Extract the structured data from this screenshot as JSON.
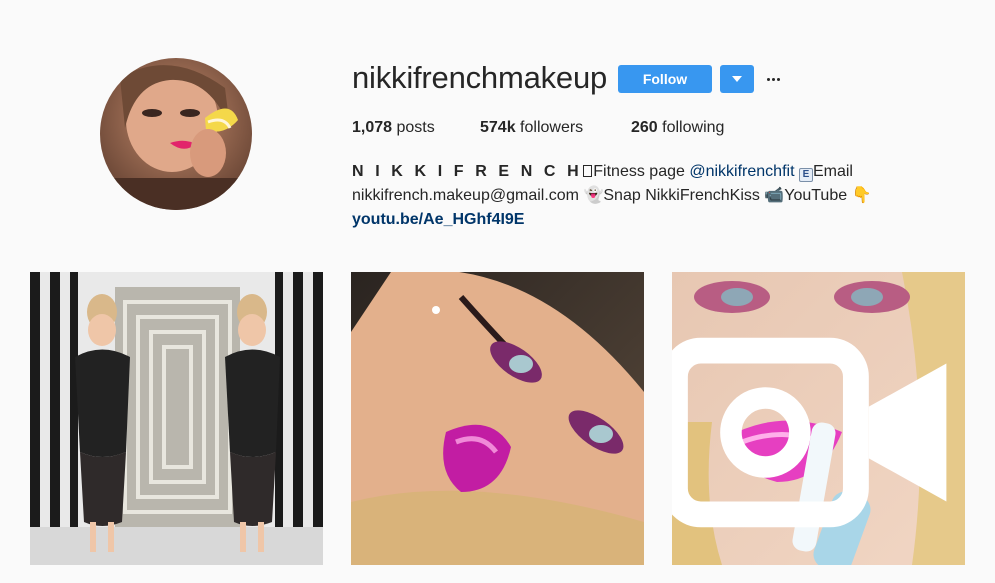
{
  "profile": {
    "username": "nikkifrenchmakeup",
    "follow_label": "Follow"
  },
  "stats": {
    "posts_count": "1,078",
    "posts_label": "posts",
    "followers_count": "574k",
    "followers_label": "followers",
    "following_count": "260",
    "following_label": "following"
  },
  "bio": {
    "name": "N I K K I F R E N C H",
    "fitness_text": "Fitness page ",
    "fitness_handle": "@nikkifrenchfit",
    "email_label": "Email",
    "email": "nikkifrench.makeup@gmail.com",
    "snap_text": "Snap NikkiFrenchKiss",
    "youtube_text": "YouTube",
    "link": "youtu.be/Ae_HGhf4I9E"
  },
  "icons": {
    "avatar": "profile-photo",
    "dropdown": "chevron-down-icon",
    "more": "ellipsis-icon",
    "video": "video-camera-icon"
  },
  "colors": {
    "accent": "#3897f0",
    "link": "#003569",
    "background": "#fafafa",
    "text": "#262626"
  }
}
